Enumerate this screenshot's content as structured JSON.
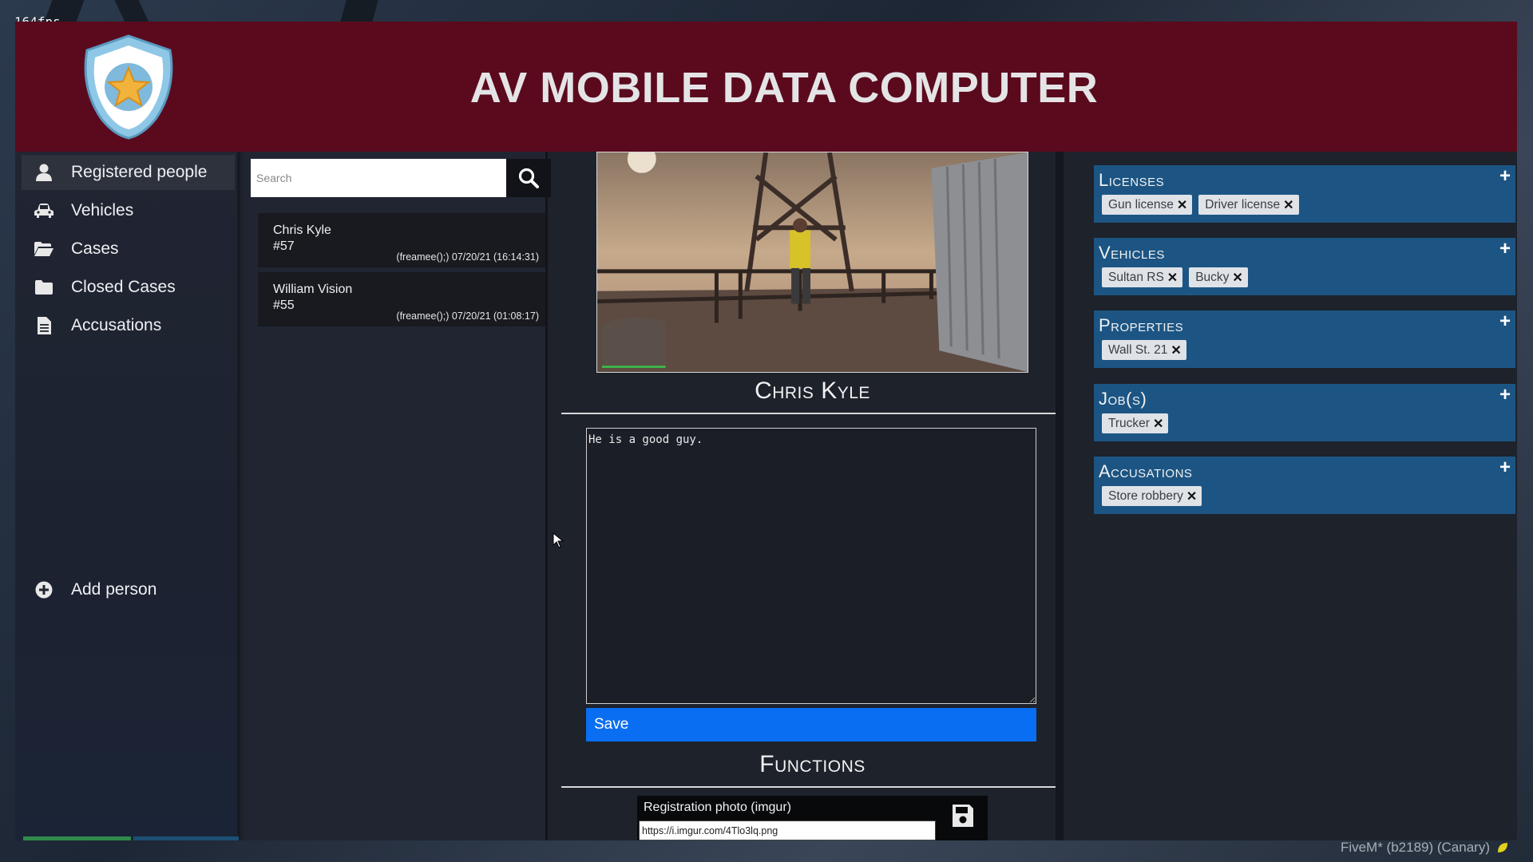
{
  "overlay": {
    "fps": "164fps",
    "fivem": "FiveM* (b2189) (Canary)"
  },
  "header": {
    "title": "AV MOBILE DATA COMPUTER"
  },
  "sidebar": {
    "items": [
      {
        "label": "Registered people",
        "icon": "user-icon",
        "active": true
      },
      {
        "label": "Vehicles",
        "icon": "car-icon"
      },
      {
        "label": "Cases",
        "icon": "folder-open-icon"
      },
      {
        "label": "Closed Cases",
        "icon": "folder-icon"
      },
      {
        "label": "Accusations",
        "icon": "file-text-icon"
      }
    ],
    "add_person": "Add person"
  },
  "search": {
    "placeholder": "Search"
  },
  "people": [
    {
      "name": "Chris Kyle",
      "id": "#57",
      "meta": "(freamee();) 07/20/21 (16:14:31)"
    },
    {
      "name": "William Vision",
      "id": "#55",
      "meta": "(freamee();) 07/20/21 (01:08:17)"
    }
  ],
  "profile": {
    "name": "Chris Kyle",
    "notes": "He is a good guy.",
    "save_label": "Save",
    "functions_title": "Functions",
    "photo_label": "Registration photo (imgur)",
    "photo_url": "https://i.imgur.com/4Tlo3lq.png"
  },
  "cards": [
    {
      "title": "Licenses",
      "tags": [
        "Gun license",
        "Driver license"
      ]
    },
    {
      "title": "Vehicles",
      "tags": [
        "Sultan RS",
        "Bucky"
      ]
    },
    {
      "title": "Properties",
      "tags": [
        "Wall St. 21"
      ]
    },
    {
      "title": "Job(s)",
      "tags": [
        "Trucker"
      ]
    },
    {
      "title": "Accusations",
      "tags": [
        "Store robbery"
      ]
    }
  ],
  "colors": {
    "header": "#5b0a1e",
    "card": "#1c5583",
    "save": "#0a6ef2"
  }
}
